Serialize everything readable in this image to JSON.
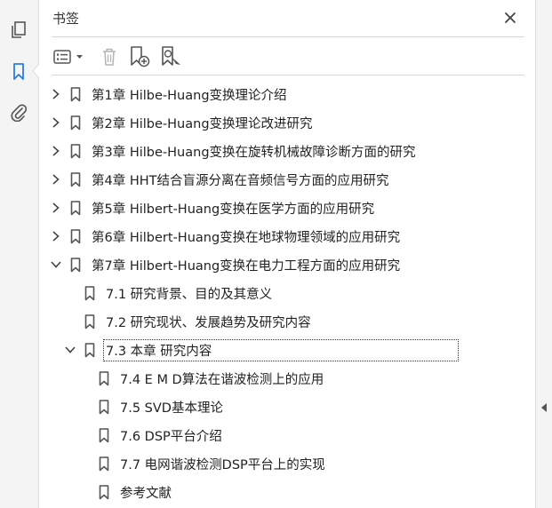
{
  "panel": {
    "title": "书签",
    "close_icon": "close-icon"
  },
  "rail": {
    "items": [
      {
        "name": "pages-icon",
        "active": false
      },
      {
        "name": "bookmarks-icon",
        "active": true
      },
      {
        "name": "attachments-icon",
        "active": false
      }
    ]
  },
  "toolbar": {
    "items": [
      "options-menu-icon",
      "delete-bookmark-icon",
      "new-bookmark-icon",
      "find-current-bookmark-icon"
    ]
  },
  "bookmarks": [
    {
      "id": "ch1",
      "label": "第1章  Hilbe-Huang变换理论介绍",
      "level": 0,
      "state": "collapsed"
    },
    {
      "id": "ch2",
      "label": "第2章  Hilbe-Huang变换理论改进研究",
      "level": 0,
      "state": "collapsed"
    },
    {
      "id": "ch3",
      "label": "第3章  Hilbe-Huang变换在旋转机械故障诊断方面的研究",
      "level": 0,
      "state": "collapsed"
    },
    {
      "id": "ch4",
      "label": "第4章  HHT结合盲源分离在音频信号方面的应用研究",
      "level": 0,
      "state": "collapsed"
    },
    {
      "id": "ch5",
      "label": "第5章  Hilbert-Huang变换在医学方面的应用研究",
      "level": 0,
      "state": "collapsed"
    },
    {
      "id": "ch6",
      "label": "第6章  Hilbert-Huang变换在地球物理领域的应用研究",
      "level": 0,
      "state": "collapsed"
    },
    {
      "id": "ch7",
      "label": "第7章  Hilbert-Huang变换在电力工程方面的应用研究",
      "level": 0,
      "state": "expanded"
    },
    {
      "id": "s71",
      "label": "7.1  研究背景、目的及其意义",
      "level": 1,
      "state": "leaf"
    },
    {
      "id": "s72",
      "label": "7.2  研究现状、发展趋势及研究内容",
      "level": 1,
      "state": "leaf"
    },
    {
      "id": "s73",
      "label": "7.3  本章  研究内容",
      "level": 1,
      "state": "expanded",
      "selected": true
    },
    {
      "id": "s74",
      "label": "7.4  E M D算法在谐波检测上的应用",
      "level": 2,
      "state": "leaf"
    },
    {
      "id": "s75",
      "label": "7.5  SVD基本理论",
      "level": 2,
      "state": "leaf"
    },
    {
      "id": "s76",
      "label": "7.6  DSP平台介绍",
      "level": 2,
      "state": "leaf"
    },
    {
      "id": "s77",
      "label": "7.7  电网谐波检测DSP平台上的实现",
      "level": 2,
      "state": "leaf"
    },
    {
      "id": "ref",
      "label": "参考文献",
      "level": 2,
      "state": "leaf"
    }
  ],
  "colors": {
    "accent": "#2a7de1",
    "icon": "#555555",
    "disabled": "#b4b4b4"
  }
}
